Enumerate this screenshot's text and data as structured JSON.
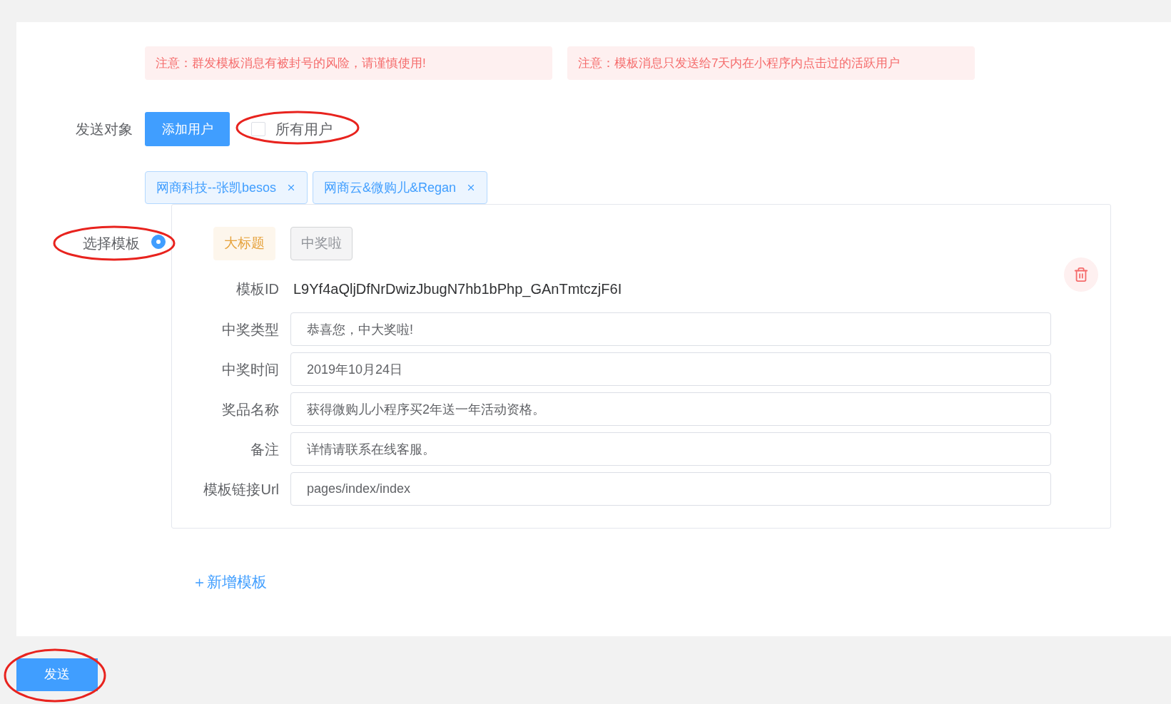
{
  "notices": [
    "注意：群发模板消息有被封号的风险，请谨慎使用!",
    "注意：模板消息只发送给7天内在小程序内点击过的活跃用户"
  ],
  "send_target": {
    "label": "发送对象",
    "add_button": "添加用户",
    "all_users": {
      "label": "所有用户",
      "checked": false
    }
  },
  "selected_users": [
    {
      "label": "网商科技--张凯besos"
    },
    {
      "label": "网商云&微购儿&Regan"
    }
  ],
  "template_select": {
    "label": "选择模板",
    "selected": true
  },
  "template": {
    "tabs": [
      {
        "label": "大标题",
        "selected": true
      },
      {
        "label": "中奖啦",
        "selected": false
      }
    ],
    "template_id": {
      "label": "模板ID",
      "value": "L9Yf4aQljDfNrDwizJbugN7hb1bPhp_GAnTmtczjF6I"
    },
    "fields": [
      {
        "label": "中奖类型",
        "value": "恭喜您，中大奖啦!"
      },
      {
        "label": "中奖时间",
        "value": "2019年10月24日"
      },
      {
        "label": "奖品名称",
        "value": "获得微购儿小程序买2年送一年活动资格。"
      },
      {
        "label": "备注",
        "value": "详情请联系在线客服。"
      },
      {
        "label": "模板链接Url",
        "value": "pages/index/index"
      }
    ]
  },
  "add_template": "＋新增模板",
  "send_button": "发送"
}
